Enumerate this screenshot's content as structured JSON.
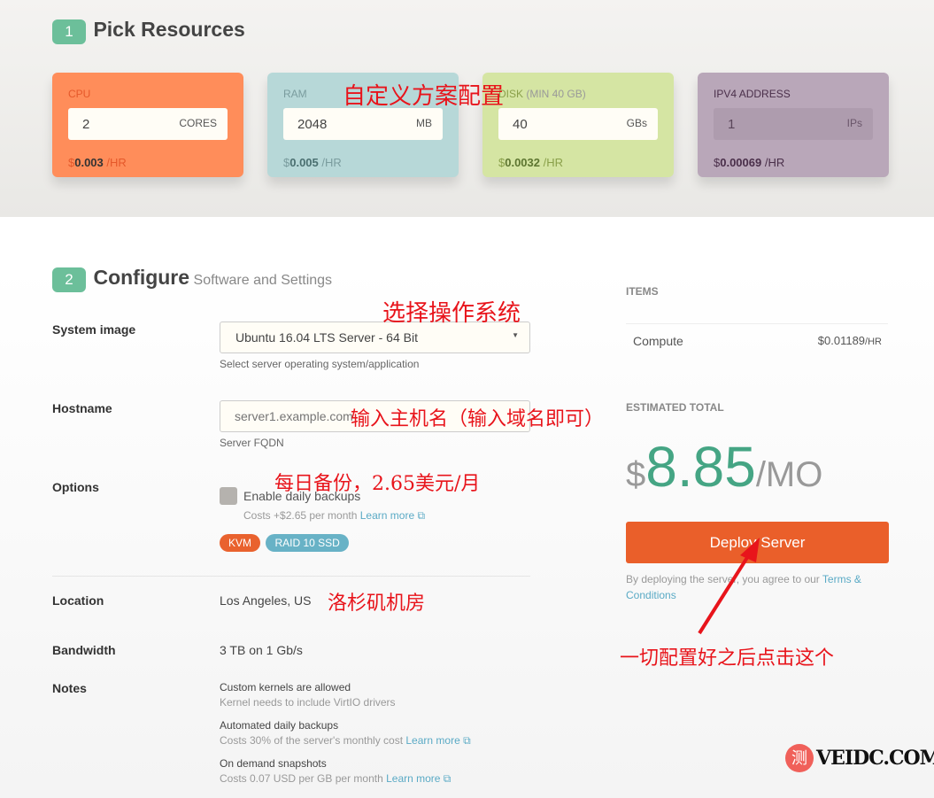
{
  "step1": {
    "num": "1",
    "title": "Pick Resources"
  },
  "cards": [
    {
      "label": "CPU",
      "value": "2",
      "unit": "CORES",
      "price_sym": "$",
      "price": "0.003",
      "per": " /HR",
      "bg": "#ff8d5a"
    },
    {
      "label": "RAM",
      "value": "2048",
      "unit": "MB",
      "price_sym": "$",
      "price": "0.005",
      "per": " /HR",
      "bg": "#b7d8d8"
    },
    {
      "label": "DISK",
      "label_note": " (MIN 40 GB)",
      "value": "40",
      "unit": "GBs",
      "price_sym": "$",
      "price": "0.0032",
      "per": " /HR",
      "bg": "#d5e5a3"
    },
    {
      "label": "IPV4 ADDRESS",
      "value": "1",
      "unit": "IPs",
      "price_sym": "$",
      "price": "0.00069",
      "per": " /HR",
      "bg": "#b9a7b9"
    }
  ],
  "step2": {
    "num": "2",
    "title": "Configure",
    "subtitle": "Software and Settings"
  },
  "system_image": {
    "label": "System image",
    "value": "Ubuntu 16.04 LTS Server - 64 Bit",
    "help": "Select server operating system/application"
  },
  "hostname": {
    "label": "Hostname",
    "placeholder": "server1.example.com",
    "help": "Server FQDN"
  },
  "options": {
    "label": "Options",
    "checkbox": "Enable daily backups",
    "cost": "Costs +$2.65 per month ",
    "learn": "Learn more",
    "badges": [
      "KVM",
      "RAID 10 SSD"
    ]
  },
  "location": {
    "label": "Location",
    "value": "Los Angeles, US"
  },
  "bandwidth": {
    "label": "Bandwidth",
    "value": "3 TB on 1 Gb/s"
  },
  "notes": {
    "label": "Notes",
    "items": [
      {
        "title": "Custom kernels are allowed",
        "desc": "Kernel needs to include VirtIO drivers"
      },
      {
        "title": "Automated daily backups",
        "desc": "Costs 30% of the server's monthly cost ",
        "learn": "Learn more"
      },
      {
        "title": "On demand snapshots",
        "desc": "Costs 0.07 USD per GB per month ",
        "learn": "Learn more"
      }
    ]
  },
  "summary": {
    "items_label": "ITEMS",
    "compute": "Compute",
    "compute_price": "$0.01189",
    "compute_per": "/HR",
    "total_label": "ESTIMATED TOTAL",
    "dollar": "$",
    "total": "8.85",
    "per": "/MO",
    "deploy": "Deploy Server",
    "terms_pre": "By deploying the server, you agree to our ",
    "terms_link": "Terms & Conditions"
  },
  "annotations": {
    "a1": "自定义方案配置",
    "a2": "选择操作系统",
    "a3": "输入主机名（输入域名即可）",
    "a4": "每日备份，2.65美元/月",
    "a5": "洛杉矶机房",
    "a6": "一切配置好之后点击这个"
  },
  "watermark": {
    "icon": "测",
    "text": "VEIDC.COM"
  }
}
